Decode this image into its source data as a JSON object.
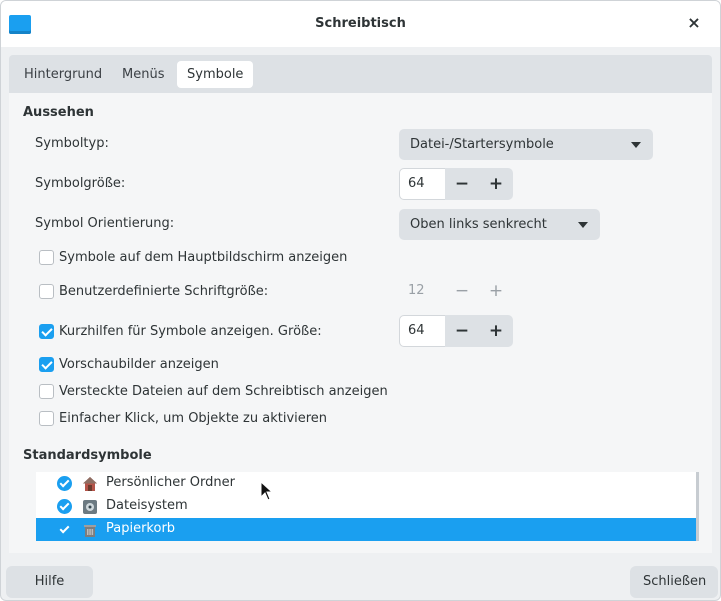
{
  "window": {
    "title": "Schreibtisch",
    "close_label": "×"
  },
  "tabs": [
    {
      "label": "Hintergrund"
    },
    {
      "label": "Menüs"
    },
    {
      "label": "Symbole"
    }
  ],
  "active_tab": "Symbole",
  "appearance": {
    "heading": "Aussehen",
    "icon_type": {
      "label": "Symboltyp:",
      "value": "Datei-/Startersymbole"
    },
    "icon_size": {
      "label": "Symbolgröße:",
      "value": "64",
      "minus": "−",
      "plus": "+"
    },
    "icon_orientation": {
      "label": "Symbol Orientierung:",
      "value": "Oben links senkrecht"
    },
    "options": [
      {
        "label": "Symbole auf dem Hauptbildschirm anzeigen",
        "checked": false
      },
      {
        "label": "Benutzerdefinierte Schriftgröße:",
        "checked": false,
        "spin_value": "12"
      },
      {
        "label": "Kurzhilfen für Symbole anzeigen. Größe:",
        "checked": true,
        "spin_value": "64"
      },
      {
        "label": "Vorschaubilder anzeigen",
        "checked": true
      },
      {
        "label": "Versteckte Dateien auf dem Schreibtisch anzeigen",
        "checked": false
      },
      {
        "label": "Einfacher Klick, um Objekte zu aktivieren",
        "checked": false
      }
    ]
  },
  "default_icons": {
    "heading": "Standardsymbole",
    "items": [
      {
        "label": "Persönlicher Ordner",
        "icon": "home-icon",
        "checked": true,
        "selected": false
      },
      {
        "label": "Dateisystem",
        "icon": "drive-icon",
        "checked": true,
        "selected": false
      },
      {
        "label": "Papierkorb",
        "icon": "trash-icon",
        "checked": true,
        "selected": true
      }
    ]
  },
  "footer": {
    "help_label": "Hilfe",
    "close_label": "Schließen"
  },
  "colors": {
    "accent": "#1a9ff0",
    "background": "#eef0f2",
    "button": "#dde1e5"
  }
}
